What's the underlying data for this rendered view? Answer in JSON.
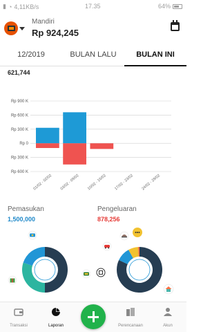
{
  "status_bar": {
    "speed": "4,11KB/s",
    "time": "17.35",
    "battery": "64%"
  },
  "header": {
    "wallet_icon": "wallet-icon",
    "account_name": "Mandiri",
    "balance": "Rp 924,245",
    "calendar_icon": "calendar-icon"
  },
  "tabs": [
    {
      "label": "12/2019"
    },
    {
      "label": "BULAN LALU"
    },
    {
      "label": "BULAN INI"
    }
  ],
  "summary": {
    "net_total": "621,744"
  },
  "chart_data": {
    "type": "bar",
    "categories": [
      "01/02 - 02/02",
      "03/02 - 09/02",
      "10/02 - 16/02",
      "17/02 - 23/02",
      "24/02 - 29/02"
    ],
    "series": [
      {
        "name": "Pemasukan",
        "color": "#1e9ad6",
        "values": [
          330000,
          660000,
          0,
          0,
          0
        ]
      },
      {
        "name": "Pengeluaran",
        "color": "#ef5350",
        "values": [
          -100000,
          -450000,
          -120000,
          0,
          0
        ]
      }
    ],
    "y_ticks": [
      900000,
      600000,
      300000,
      0,
      -300000,
      -600000
    ],
    "y_tick_labels": [
      "Rp 900 K",
      "Rp 600 K",
      "Rp 300 K",
      "Rp 0",
      "Rp 300 K",
      "Rp 600 K"
    ],
    "ylim": [
      -600000,
      900000
    ],
    "grid": true
  },
  "income": {
    "label": "Pemasukan",
    "value": "1,500,000"
  },
  "expense": {
    "label": "Pengeluaran",
    "value": "878,256"
  },
  "donuts": {
    "income_segments": [
      {
        "color": "#263d52",
        "value": 50
      },
      {
        "color": "#2cb5a0",
        "value": 30
      },
      {
        "color": "#2196d6",
        "value": 20
      }
    ],
    "expense_segments": [
      {
        "color": "#263d52",
        "value": 82
      },
      {
        "color": "#2196d6",
        "value": 10
      },
      {
        "color": "#f2c230",
        "value": 7
      },
      {
        "color": "#ff7043",
        "value": 1
      }
    ],
    "category_icons": [
      "money-icon",
      "gift-icon",
      "salary-icon",
      "transfer-icon",
      "car-icon",
      "food-icon",
      "shopping-icon",
      "home-icon"
    ]
  },
  "bottom_nav": [
    {
      "label": "Transaksi",
      "icon": "wallet-icon"
    },
    {
      "label": "Laporan",
      "icon": "pie-chart-icon"
    },
    {
      "label": "Perencanaan",
      "icon": "planning-icon"
    },
    {
      "label": "Akun",
      "icon": "account-icon"
    }
  ],
  "fab_icon": "plus-icon"
}
